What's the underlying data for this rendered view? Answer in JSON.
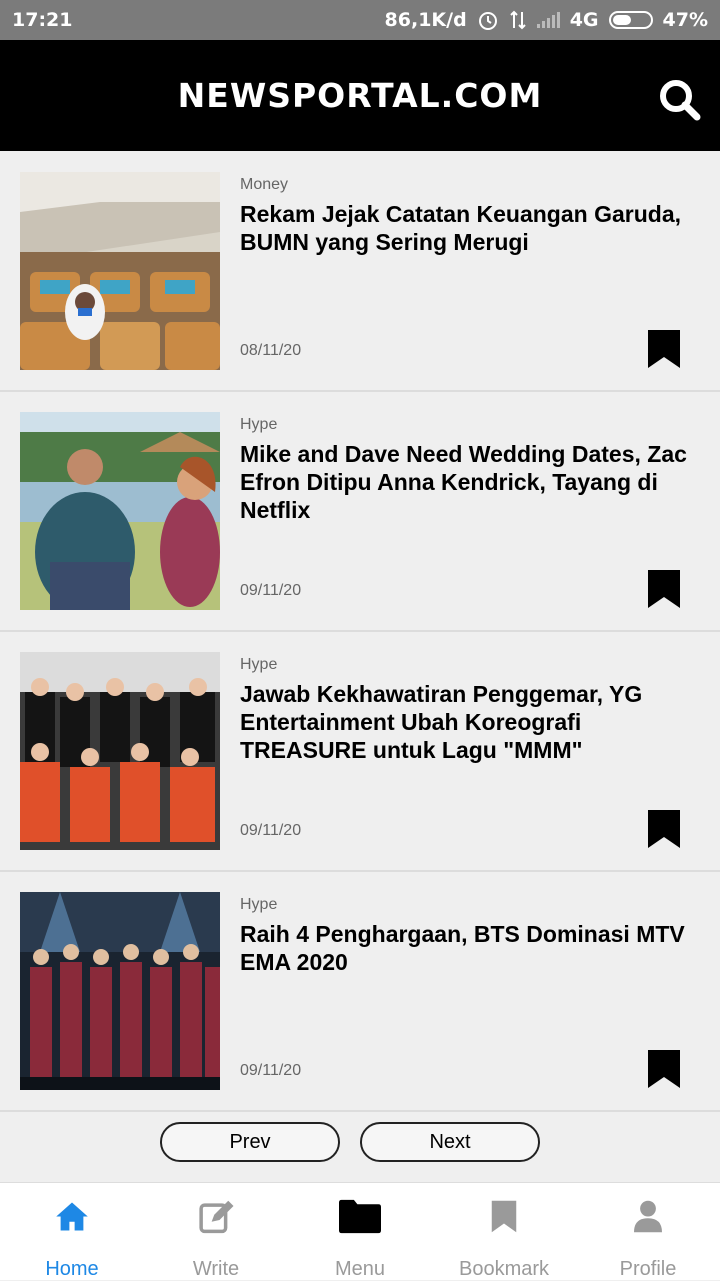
{
  "status_bar": {
    "time": "17:21",
    "speed": "86,1K/d",
    "network": "4G",
    "battery": "47%"
  },
  "app_bar": {
    "title": "NEWSPORTAL.COM",
    "search_icon": "search-icon"
  },
  "articles": [
    {
      "category": "Money",
      "title": "Rekam Jejak Catatan Keuangan Garuda, BUMN yang Sering Merugi",
      "date": "08/11/20",
      "image": "airplane-cabin-photo"
    },
    {
      "category": "Hype",
      "title": "Mike and Dave Need Wedding Dates, Zac Efron Ditipu Anna Kendrick, Tayang di Netflix",
      "date": "09/11/20",
      "image": "movie-still-photo"
    },
    {
      "category": "Hype",
      "title": "Jawab Kekhawatiran Penggemar, YG Entertainment Ubah Koreografi TREASURE untuk Lagu \"MMM\"",
      "date": "09/11/20",
      "image": "group-photo"
    },
    {
      "category": "Hype",
      "title": "Raih 4 Penghargaan, BTS Dominasi MTV EMA 2020",
      "date": "09/11/20",
      "image": "stage-photo"
    }
  ],
  "pagination": {
    "prev": "Prev",
    "next": "Next"
  },
  "bottom_nav": [
    {
      "label": "Home",
      "icon": "home-icon",
      "active": true
    },
    {
      "label": "Write",
      "icon": "edit-icon",
      "active": false
    },
    {
      "label": "Menu",
      "icon": "folder-icon",
      "active": false
    },
    {
      "label": "Bookmark",
      "icon": "bookmark-icon",
      "active": false
    },
    {
      "label": "Profile",
      "icon": "person-icon",
      "active": false
    }
  ],
  "colors": {
    "accent": "#1e88e5",
    "inactive": "#9a9a9a",
    "appbar": "#000000"
  }
}
